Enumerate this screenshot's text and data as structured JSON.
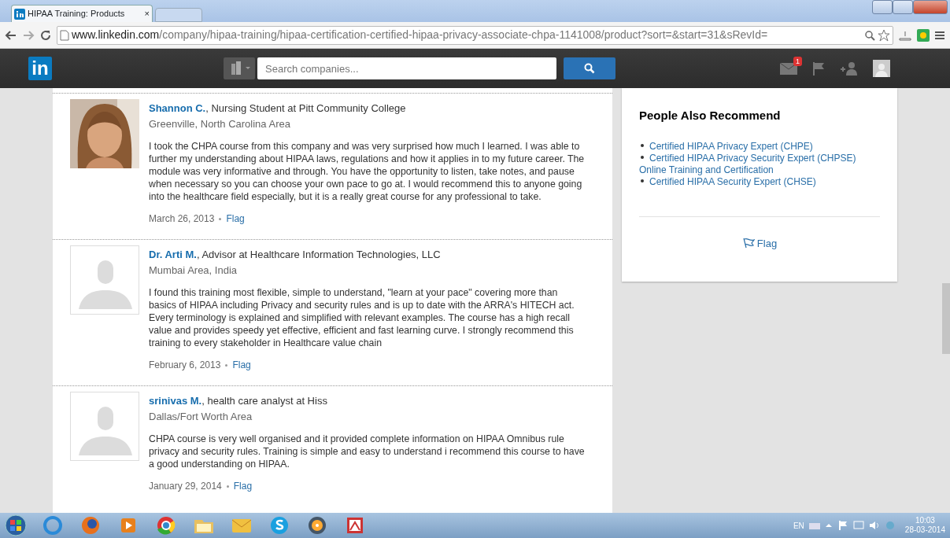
{
  "browser": {
    "tab": {
      "title": "HIPAA Training: Products",
      "close": "×"
    },
    "url_host": "www.linkedin.com",
    "url_path": "/company/hipaa-training/hipaa-certification-certified-hipaa-privacy-associate-chpa-1141008/product?sort=&start=31&sRevId="
  },
  "navbar": {
    "logo": "in",
    "search": {
      "placeholder": "Search companies..."
    },
    "messages_badge": "1"
  },
  "reviews": [
    {
      "name": "Shannon C.",
      "headline": ", Nursing Student at Pitt Community College",
      "location": "Greenville, North Carolina Area",
      "text": "I took the CHPA course from this company and was very surprised how much I learned. I was able to further my understanding about HIPAA laws, regulations and how it applies in to my future career. The module was very informative and through. You have the opportunity to listen, take notes, and pause when necessary so you can choose your own pace to go at. I would recommend this to anyone going into the healthcare field especially, but it is a really great course for any professional to take.",
      "date": "March 26, 2013",
      "flag": "Flag"
    },
    {
      "avatar": {
        "kind": "placeholder"
      },
      "name": "Dr. Arti M.",
      "headline": ", Advisor at Healthcare Information Technologies, LLC",
      "location": "Mumbai Area, India",
      "text": "I found this training most flexible, simple to understand, \"learn at your pace\" covering more than basics of HIPAA including Privacy and security rules and is up to date with the ARRA's HITECH act. Every terminology is explained and simplified with relevant examples. The course has a high recall value and provides speedy yet effective, efficient and fast learning curve. I strongly recommend this training to every stakeholder in Healthcare value chain",
      "date": "February 6, 2013",
      "flag": "Flag"
    },
    {
      "avatar": {
        "kind": "placeholder"
      },
      "name": "srinivas M.",
      "headline": ", health care analyst at Hiss",
      "location": "Dallas/Fort Worth Area",
      "text": "CHPA course is very well organised and it provided complete information on HIPAA Omnibus rule privacy and security rules. Training is simple and easy to understand i recommend this course to have a good understanding on HIPAA.",
      "date": "January 29, 2014",
      "flag": "Flag"
    }
  ],
  "recommend": {
    "title": "People Also Recommend",
    "items": [
      {
        "lines": [
          "Certified HIPAA Privacy Expert (CHPE)"
        ]
      },
      {
        "lines": [
          "Certified HIPAA Privacy Security Expert (CHPSE)",
          "Online Training and Certification"
        ]
      },
      {
        "lines": [
          "Certified HIPAA Security Expert (CHSE)"
        ]
      }
    ],
    "flag": "Flag"
  },
  "taskbar": {
    "language": "EN",
    "time": "10:03",
    "date": "28-03-2014"
  }
}
